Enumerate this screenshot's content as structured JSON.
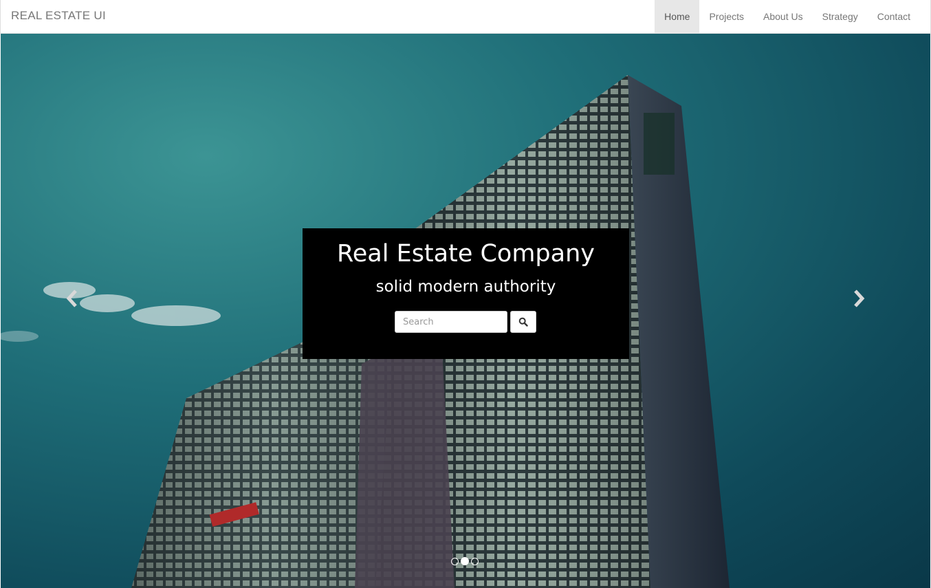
{
  "navbar": {
    "brand": "REAL ESTATE UI",
    "items": [
      {
        "label": "Home",
        "active": true
      },
      {
        "label": "Projects",
        "active": false
      },
      {
        "label": "About Us",
        "active": false
      },
      {
        "label": "Strategy",
        "active": false
      },
      {
        "label": "Contact",
        "active": false
      }
    ]
  },
  "hero": {
    "title": "Real Estate Company",
    "subtitle": "solid modern authority",
    "search": {
      "placeholder": "Search"
    },
    "controls": {
      "prev_icon": "chevron-left-icon",
      "next_icon": "chevron-right-icon"
    },
    "indicators": {
      "count": 3,
      "active_index": 1
    }
  },
  "colors": {
    "sky": "#1f6e78",
    "caption_bg": "#000000",
    "nav_active_bg": "#e7e7e7",
    "nav_text": "#777777"
  }
}
